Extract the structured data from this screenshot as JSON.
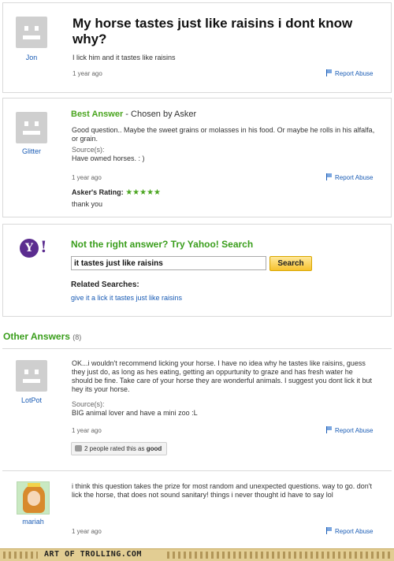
{
  "question": {
    "asker": "Jon",
    "title": "My horse tastes just like raisins i dont know why?",
    "details": "I lick him and it tastes like raisins",
    "time": "1 year ago",
    "report": "Report Abuse"
  },
  "best_answer": {
    "user": "Glitter",
    "label": "Best Answer",
    "chosen_by": " - Chosen by Asker",
    "text": "Good question.. Maybe the sweet grains or molasses in his food. Or maybe he rolls in his alfalfa, or grain.",
    "source_label": "Source(s):",
    "source": "Have owned horses. : )",
    "time": "1 year ago",
    "report": "Report Abuse",
    "rating_label": "Asker's Rating:",
    "rating_stars": "★★★★★",
    "rating_value": 5,
    "rating_comment": "thank you"
  },
  "yahoo_search": {
    "logo": "Y",
    "logo_bang": "!",
    "heading": "Not the right answer? Try Yahoo! Search",
    "query": "it tastes just like raisins",
    "button": "Search",
    "related_heading": "Related Searches:",
    "related_link": "give it a lick it tastes just like raisins"
  },
  "other_answers": {
    "heading": "Other Answers",
    "count": "(8)",
    "items": [
      {
        "user": "LotPot",
        "text": "OK...i wouldn't recommend licking your horse. I have no idea why he tastes like raisins, guess they just do, as long as hes eating, getting an oppurtunity to graze and has fresh water he should be fine. Take care of your horse they are wonderful animals. I suggest you dont lick it but hey its your horse.",
        "source_label": "Source(s):",
        "source": "BIG animal lover and have a mini zoo :L",
        "time": "1 year ago",
        "report": "Report Abuse",
        "rated_prefix": "2 people rated this as ",
        "rated_value": "good"
      },
      {
        "user": "mariah",
        "text": "i think this question takes the prize for most random and unexpected questions. way to go. don't lick the horse, that does not sound sanitary! things i never thought id have to say lol",
        "time": "1 year ago",
        "report": "Report Abuse"
      }
    ]
  },
  "footer": {
    "brand": "ART OF TROLLING.COM"
  }
}
